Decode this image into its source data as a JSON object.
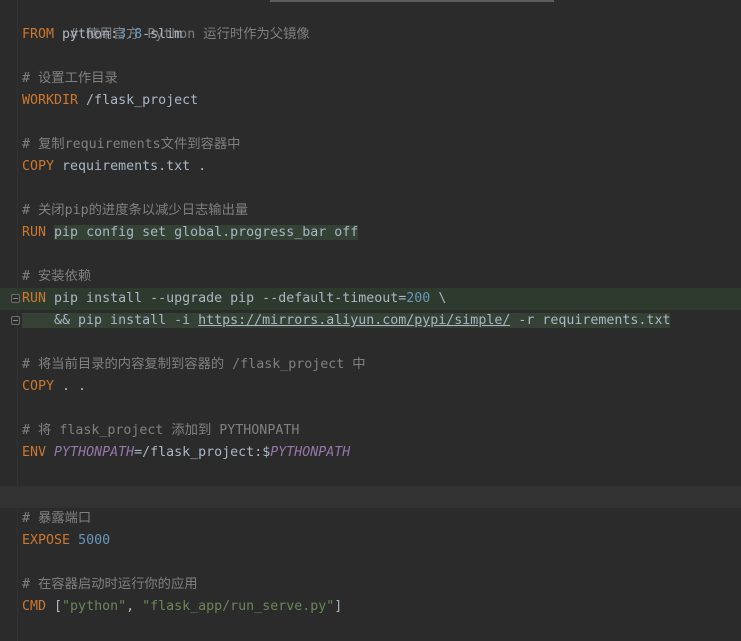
{
  "lines": {
    "l1": [
      "# 使用官方 Python 运行时作为父镜像"
    ],
    "l2": [
      "FROM",
      " python:",
      "3.8",
      "-slim"
    ],
    "l3": [
      "# 设置工作目录"
    ],
    "l4": [
      "WORKDIR",
      " /flask_project"
    ],
    "l5": [
      "# 复制requirements文件到容器中"
    ],
    "l6": [
      "COPY",
      " requirements.txt ."
    ],
    "l7": [
      "# 关闭pip的进度条以减少日志输出量"
    ],
    "l8": [
      "RUN",
      " ",
      "pip config set global.progress_bar off"
    ],
    "l9": [
      "# 安装依赖"
    ],
    "l10": [
      "RUN",
      " pip install --upgrade pip --default-timeout=",
      "200",
      " \\"
    ],
    "l11": [
      "    && pip install -i ",
      "https://mirrors.aliyun.com/pypi/simple/",
      " -r requirements.txt"
    ],
    "l12": [
      "# 将当前目录的内容复制到容器的 /flask_project 中"
    ],
    "l13": [
      "COPY",
      " . ."
    ],
    "l14": [
      "# 将 flask_project 添加到 PYTHONPATH"
    ],
    "l15": [
      "ENV",
      " ",
      "PYTHONPATH",
      "=/flask_project:$",
      "PYTHONPATH"
    ],
    "l16": [
      "# 暴露端口"
    ],
    "l17": [
      "EXPOSE",
      " ",
      "5000"
    ],
    "l18": [
      "# 在容器启动时运行你的应用"
    ],
    "l19": [
      "CMD",
      " [",
      "\"python\"",
      ", ",
      "\"flask_app/run_serve.py\"",
      "]"
    ]
  },
  "theme": {
    "background": "#2b2b2b",
    "keyword": "#cc7832",
    "comment": "#808080",
    "number": "#6897bb",
    "string": "#6a8759",
    "variable": "#9876aa",
    "text": "#a9b7c6"
  }
}
